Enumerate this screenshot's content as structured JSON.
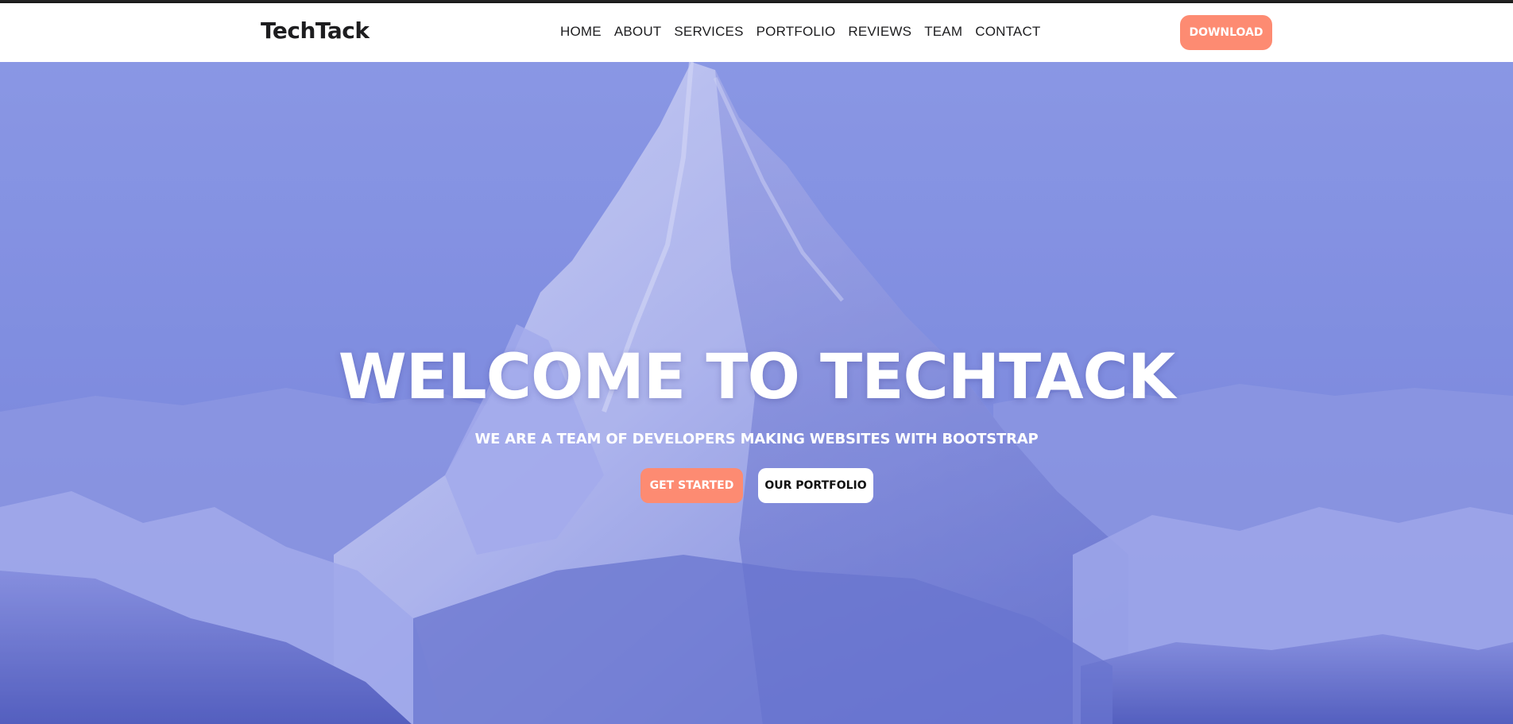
{
  "navbar": {
    "brand": "TechTack",
    "links": [
      "HOME",
      "ABOUT",
      "SERVICES",
      "PORTFOLIO",
      "REVIEWS",
      "TEAM",
      "CONTACT"
    ],
    "download_label": "DOWNLOAD"
  },
  "hero": {
    "title": "WELCOME TO TECHTACK",
    "subtitle": "WE ARE A TEAM OF DEVELOPERS MAKING WEBSITES WITH BOOTSTRAP",
    "primary_button": "GET STARTED",
    "secondary_button": "OUR PORTFOLIO",
    "background_image": "snow-capped-mountain-peak"
  },
  "colors": {
    "accent": "#fd8b72",
    "navbar_bg": "#ffffff",
    "hero_overlay": "#7d8ce0",
    "text_dark": "#1d1d1f"
  }
}
